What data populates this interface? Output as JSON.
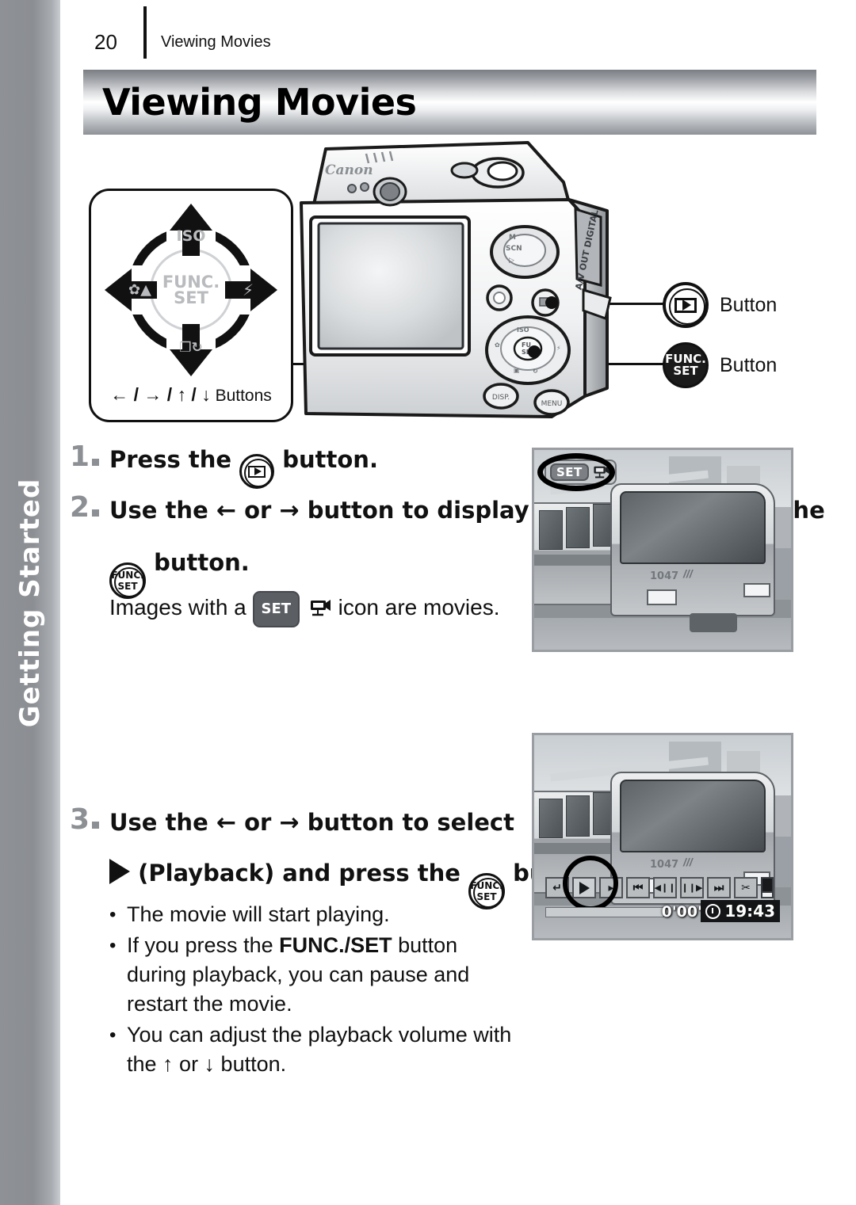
{
  "sidebar": {
    "tab_label": "Getting Started"
  },
  "header": {
    "page_number": "20",
    "running_title": "Viewing Movies"
  },
  "title_banner": {
    "title": "Viewing Movies"
  },
  "nav_diagram": {
    "caption_arrows": "← / → / ↑ / ↓",
    "caption_text": "Buttons",
    "ring_top_label": "ISO",
    "ring_center_label_line1": "FUNC.",
    "ring_center_label_line2": "SET",
    "ring_left_label": "✿▲",
    "ring_right_label": "⚡",
    "ring_bottom_label": "❐↻"
  },
  "camera": {
    "brand": "Canon",
    "port_label": "A/V OUT DIGITAL",
    "mode_dial_labels": "M SCN",
    "disp_button": "DISP.",
    "menu_button": "MENU"
  },
  "callouts": [
    {
      "icon": "playback-button-icon",
      "label": "Button"
    },
    {
      "icon": "func-set-button-icon",
      "label": "Button"
    }
  ],
  "steps": [
    {
      "number": "1",
      "text_before": "Press the",
      "icon": "playback-button-icon",
      "text_after": "button."
    },
    {
      "number": "2",
      "line1_a": "Use the",
      "arrow_left": "←",
      "line1_or": "or",
      "arrow_right": "→",
      "line1_b": "button to display a movie and press the",
      "icon": "func-set-button-icon",
      "line2": "button.",
      "note_a": "Images with a",
      "note_badge": "SET",
      "note_b": "icon are movies."
    },
    {
      "number": "3",
      "line1_a": "Use the",
      "arrow_left": "←",
      "line1_or": "or",
      "arrow_right": "→",
      "line1_b": "button to select",
      "line2_a": "(Playback) and press the",
      "icon": "func-set-button-icon",
      "line2_b": "button."
    }
  ],
  "bullets": [
    {
      "text": "The movie will start playing."
    },
    {
      "pre": "If you press the ",
      "bold": "FUNC./SET",
      "post": " button during playback, you can pause and restart the movie."
    },
    {
      "pre": "You can adjust the playback volume with the ",
      "bold": "",
      "post": " ↑ or ↓ button."
    }
  ],
  "photo_top": {
    "badge_set": "SET",
    "badge_icon": "movie-camera-icon"
  },
  "photo_bottom": {
    "controls": [
      {
        "name": "exit-icon",
        "glyph": "↵"
      },
      {
        "name": "play-icon",
        "glyph": "▶"
      },
      {
        "name": "slow-motion-icon",
        "glyph": "▸"
      },
      {
        "name": "first-frame-icon",
        "glyph": "⏮"
      },
      {
        "name": "previous-frame-icon",
        "glyph": "◀❙❙"
      },
      {
        "name": "next-frame-icon",
        "glyph": "❙❙▶"
      },
      {
        "name": "last-frame-icon",
        "glyph": "⏭"
      },
      {
        "name": "edit-scissors-icon",
        "glyph": "✂"
      },
      {
        "name": "save-icon",
        "glyph": ""
      }
    ],
    "time_elapsed": "0'00\"",
    "clock_time": "19:43"
  },
  "colors": {
    "sidebar_gray": "#8b8e93",
    "step_number_gray": "#8c8f94",
    "banner_dark": "#7b7e83",
    "text_black": "#111111"
  }
}
